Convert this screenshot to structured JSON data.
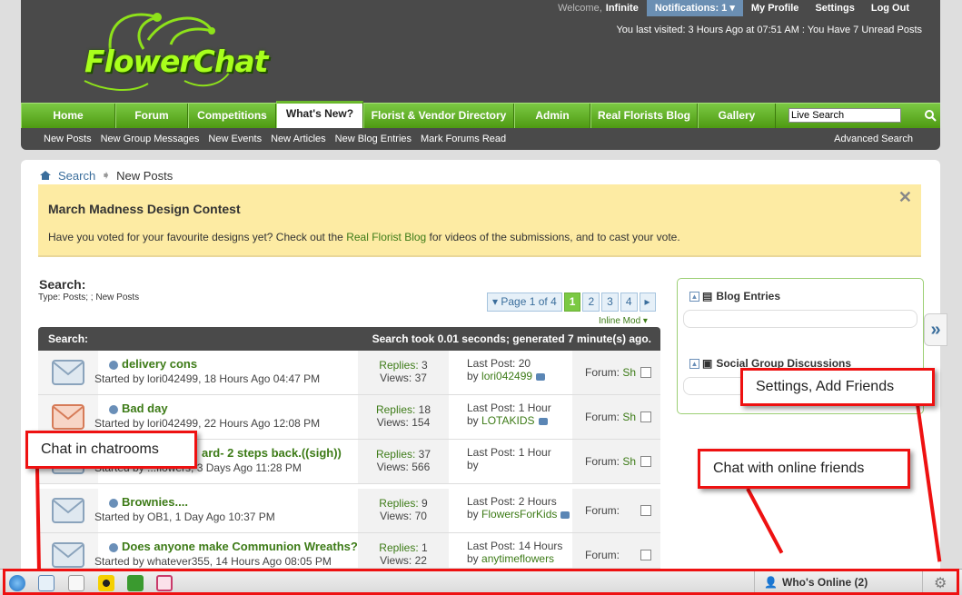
{
  "header": {
    "logo_text": "FlowerChat",
    "welcome": "Welcome,",
    "username": "Infinite",
    "notifications": "Notifications: 1",
    "my_profile": "My Profile",
    "settings": "Settings",
    "logout": "Log Out",
    "last_visited": "You last visited: 3 Hours Ago at 07:51 AM : You Have 7 Unread Posts"
  },
  "nav": {
    "tabs": [
      {
        "label": "Home"
      },
      {
        "label": "Forum"
      },
      {
        "label": "Competitions"
      },
      {
        "label": "What's New?"
      },
      {
        "label": "Florist & Vendor Directory"
      },
      {
        "label": "Admin"
      },
      {
        "label": "Real Florists Blog"
      },
      {
        "label": "Gallery"
      }
    ],
    "search_placeholder": "Live Search"
  },
  "subnav": {
    "items": [
      "New Posts",
      "New Group Messages",
      "New Events",
      "New Articles",
      "New Blog Entries",
      "Mark Forums Read"
    ],
    "advanced": "Advanced Search"
  },
  "breadcrumb": {
    "search": "Search",
    "current": "New Posts"
  },
  "notice": {
    "title": "March Madness Design Contest",
    "body_pre": "Have you voted for your favourite designs yet? Check out the ",
    "body_link": "Real Florist Blog",
    "body_post": " for videos of the submissions, and to cast your vote."
  },
  "search": {
    "heading": "Search:",
    "subtitle": "Type: Posts; ; New Posts",
    "page_of": "Page 1 of 4",
    "pages": [
      "1",
      "2",
      "3",
      "4"
    ],
    "inline_mod": "Inline Mod",
    "results_label": "Search:",
    "results_time": "Search took 0.01 seconds; generated 7 minute(s) ago."
  },
  "threads": [
    {
      "title": "delivery cons",
      "by": "Started by lori042499, 18 Hours Ago 04:47 PM",
      "replies": "3",
      "views": "37",
      "last": "Last Post: 20",
      "last_by": "lori042499",
      "forum": "Sh"
    },
    {
      "title": "Bad day",
      "by": "Started by lori042499, 22 Hours Ago 12:08 PM",
      "replies": "18",
      "views": "154",
      "last": "Last Post: 1 Hour",
      "last_by": "LOTAKIDS",
      "forum": "Sh"
    },
    {
      "title": "ard- 2 steps back.((sigh))",
      "by": "Started by ...flowers, 3 Days Ago 11:28 PM",
      "replies": "37",
      "views": "566",
      "last": "Last Post: 1 Hour",
      "last_by": "",
      "forum": "Sh"
    },
    {
      "title": "Brownies....",
      "by": "Started by OB1, 1 Day Ago 10:37 PM",
      "replies": "9",
      "views": "70",
      "last": "Last Post: 2 Hours",
      "last_by": "FlowersForKids",
      "forum": ""
    },
    {
      "title": "Does anyone make Communion Wreaths?",
      "by": "Started by whatever355, 14 Hours Ago 08:05 PM",
      "replies": "1",
      "views": "22",
      "last": "Last Post: 14 Hours",
      "last_by": "anytimeflowers",
      "forum": ""
    }
  ],
  "labels": {
    "replies": "Replies:",
    "views": "Views:",
    "by": "by",
    "forum": "Forum:"
  },
  "sidebar": {
    "blog_entries": "Blog Entries",
    "social_groups": "Social Group Discussions"
  },
  "callouts": {
    "chatrooms": "Chat in chatrooms",
    "friends": "Chat with online friends",
    "settings": "Settings, Add Friends"
  },
  "bottombar": {
    "whos_online": "Who's Online (2)"
  }
}
